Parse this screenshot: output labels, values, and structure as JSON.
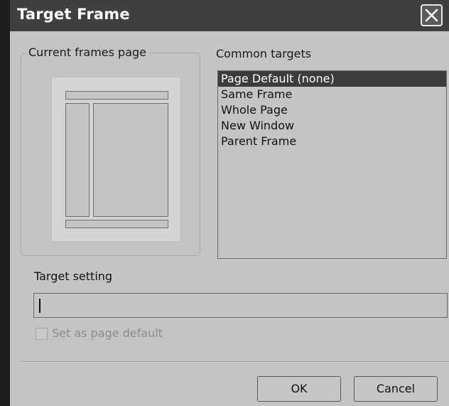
{
  "window": {
    "title": "Target Frame",
    "close_icon": "close-icon"
  },
  "frames_group": {
    "label": "Current frames page"
  },
  "targets": {
    "label": "Common targets",
    "items": [
      {
        "label": "Page Default (none)",
        "selected": true
      },
      {
        "label": "Same Frame",
        "selected": false
      },
      {
        "label": "Whole Page",
        "selected": false
      },
      {
        "label": "New Window",
        "selected": false
      },
      {
        "label": "Parent Frame",
        "selected": false
      }
    ]
  },
  "setting": {
    "label": "Target setting",
    "value": ""
  },
  "checkbox": {
    "label": "Set as page default",
    "checked": false,
    "enabled": false
  },
  "buttons": {
    "ok_label": "OK",
    "cancel_label": "Cancel"
  },
  "colors": {
    "selection": "#3c3c3c",
    "dialog_bg": "#c4c4c4",
    "title_bg": "#404040"
  }
}
